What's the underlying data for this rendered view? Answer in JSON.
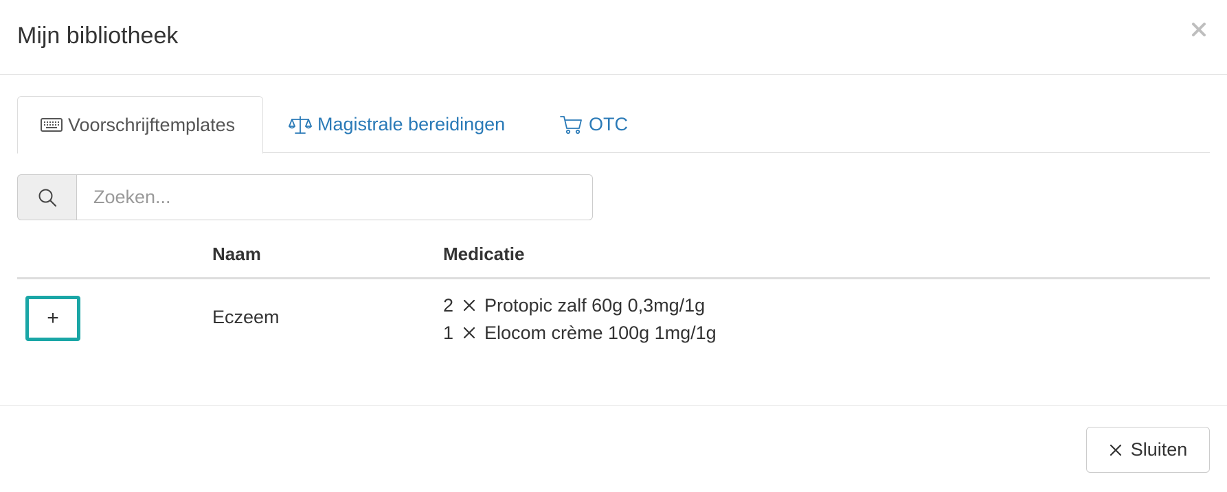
{
  "modal": {
    "title": "Mijn bibliotheek",
    "close_icon": "close-icon"
  },
  "tabs": [
    {
      "label": "Voorschrijftemplates",
      "icon": "keyboard-icon",
      "active": true
    },
    {
      "label": "Magistrale bereidingen",
      "icon": "balance-scale-icon",
      "active": false
    },
    {
      "label": "OTC",
      "icon": "shopping-cart-icon",
      "active": false
    }
  ],
  "search": {
    "placeholder": "Zoeken...",
    "value": "",
    "icon": "search-icon"
  },
  "table": {
    "columns": [
      "",
      "Naam",
      "Medicatie"
    ],
    "rows": [
      {
        "add_label": "+",
        "naam": "Eczeem",
        "medicatie": [
          {
            "qty": "2",
            "name": "Protopic zalf 60g 0,3mg/1g"
          },
          {
            "qty": "1",
            "name": "Elocom crème 100g 1mg/1g"
          }
        ]
      }
    ]
  },
  "footer": {
    "close_label": "Sluiten",
    "close_icon": "close-icon"
  },
  "colors": {
    "link": "#2a7ab7",
    "highlight": "#1aa6a6",
    "border": "#dddddd"
  }
}
